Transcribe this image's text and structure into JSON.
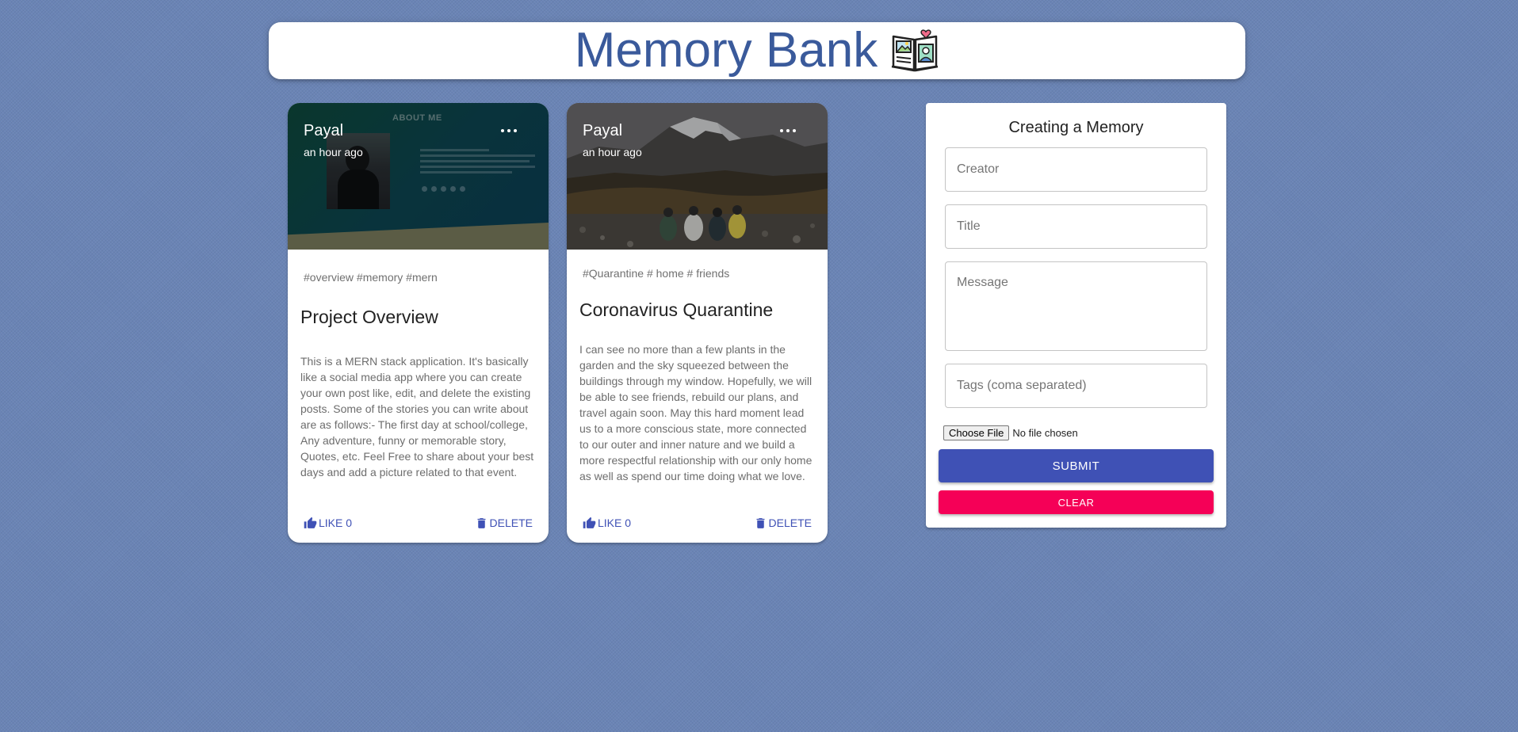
{
  "app": {
    "title": "Memory Bank",
    "logo_icon": "memory-book-icon"
  },
  "posts": [
    {
      "creator": "Payal",
      "time": "an hour ago",
      "image_text": "ABOUT ME",
      "tags": "#overview #memory #mern",
      "title": "Project Overview",
      "message": "This is a MERN stack application. It's basically like a social media app where you can create your own post like, edit, and delete the existing posts. Some of the stories you can write about are as follows:- The first day at school/college, Any adventure, funny or memorable story, Quotes, etc. Feel Free to share about your best days and add a picture related to that event.",
      "like_label": "LIKE",
      "like_count": "0",
      "delete_label": "DELETE"
    },
    {
      "creator": "Payal",
      "time": "an hour ago",
      "tags": "#Quarantine # home # friends",
      "title": "Coronavirus Quarantine",
      "message": "I can see no more than a few plants in the garden and the sky squeezed between the buildings through my window. Hopefully, we will be able to see friends, rebuild our plans, and travel again soon. May this hard moment lead us to a more conscious state, more connected to our outer and inner nature and we build a more respectful relationship with our only home as well as spend our time doing what we love.",
      "like_label": "LIKE",
      "like_count": "0",
      "delete_label": "DELETE"
    }
  ],
  "form": {
    "heading": "Creating a Memory",
    "creator_placeholder": "Creator",
    "title_placeholder": "Title",
    "message_placeholder": "Message",
    "tags_placeholder": "Tags (coma separated)",
    "file_button": "Choose File",
    "file_status": "No file chosen",
    "submit_label": "SUBMIT",
    "clear_label": "CLEAR"
  },
  "colors": {
    "background": "#6a84b5",
    "title": "#3a5a9b",
    "primary": "#3f51b5",
    "secondary": "#f50057"
  }
}
